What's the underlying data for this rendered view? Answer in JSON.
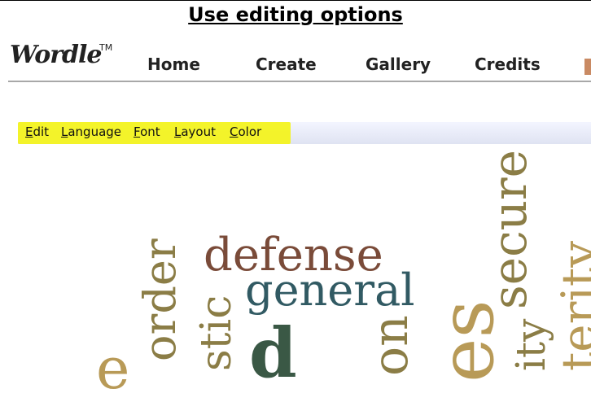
{
  "slide": {
    "title": "Use editing options"
  },
  "app": {
    "logo": "Wordle",
    "trademark": "TM"
  },
  "nav": {
    "items": [
      "Home",
      "Create",
      "Gallery",
      "Credits"
    ]
  },
  "toolbar": {
    "menus": [
      {
        "first": "E",
        "rest": "dit"
      },
      {
        "first": "L",
        "rest": "anguage"
      },
      {
        "first": "F",
        "rest": "ont"
      },
      {
        "first": "L",
        "rest": "ayout"
      },
      {
        "first": "C",
        "rest": "olor"
      }
    ],
    "highlight_color": "#f3f31f"
  },
  "cloud": {
    "words": [
      "defense",
      "general",
      "secure",
      "order",
      "stic",
      "ity",
      "terity",
      "d",
      "es",
      "on",
      "e"
    ],
    "colors": {
      "brown": "#7a4b39",
      "teal": "#315a63",
      "olive": "#8b7d46",
      "tan": "#b89a57",
      "darkgreen": "#3a5845"
    }
  }
}
